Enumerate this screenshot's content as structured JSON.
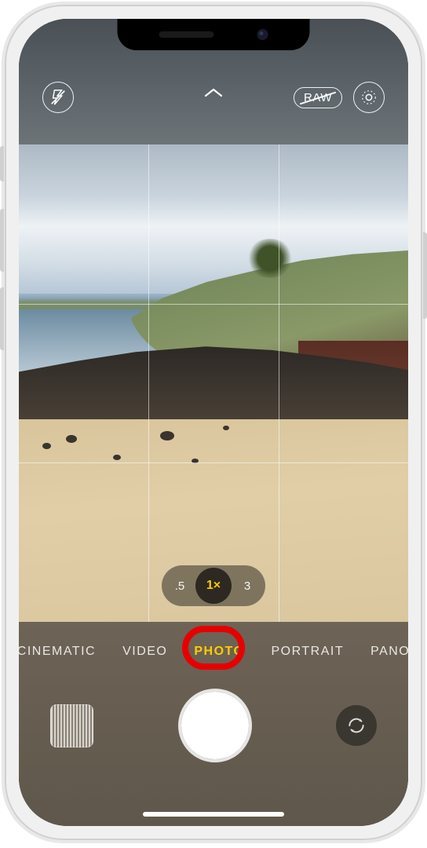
{
  "top": {
    "flash_icon": "flash-off-icon",
    "chevron_icon": "chevron-up-icon",
    "raw_label": "RAW",
    "live_icon": "live-photo-icon"
  },
  "zoom": {
    "options": [
      ".5",
      "1×",
      "3"
    ],
    "active_index": 1
  },
  "modes": {
    "items": [
      "CINEMATIC",
      "VIDEO",
      "PHOTO",
      "PORTRAIT",
      "PANO"
    ],
    "active_index": 2
  },
  "controls": {
    "thumbnail": "last-photo-thumbnail",
    "shutter": "shutter-button",
    "flip": "flip-camera-icon"
  },
  "annotation": {
    "highlight_mode_index": 2
  },
  "colors": {
    "accent": "#ffcc00",
    "annotation": "#e60000"
  }
}
